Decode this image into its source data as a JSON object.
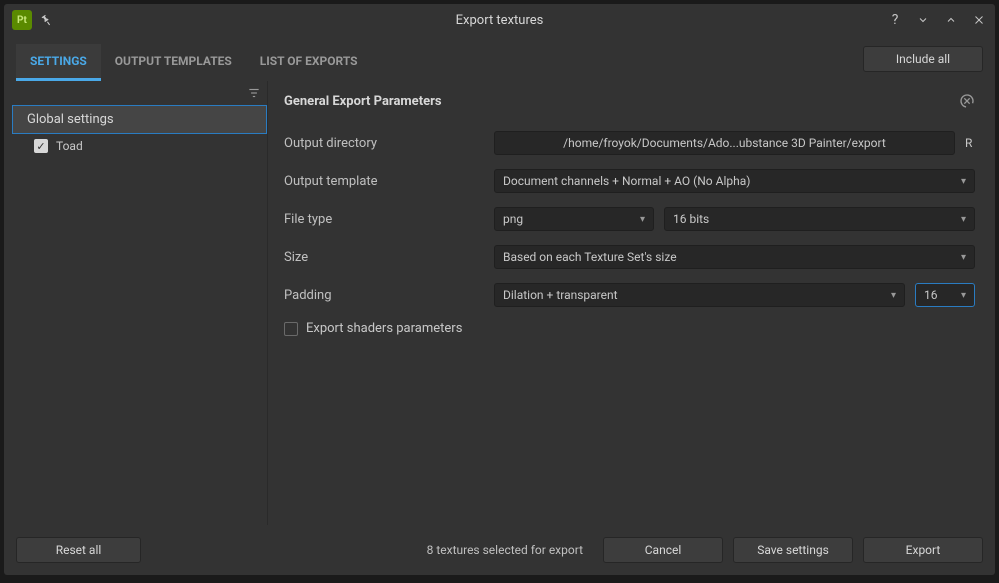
{
  "window": {
    "title": "Export textures",
    "app_icon_text": "Pt"
  },
  "toolbar": {
    "tabs": [
      {
        "label": "SETTINGS",
        "active": true
      },
      {
        "label": "OUTPUT TEMPLATES",
        "active": false
      },
      {
        "label": "LIST OF EXPORTS",
        "active": false
      }
    ],
    "include_all": "Include all"
  },
  "sidebar": {
    "header": "Global settings",
    "items": [
      {
        "label": "Toad",
        "checked": true
      }
    ]
  },
  "content": {
    "title": "General Export Parameters",
    "output_directory": {
      "label": "Output directory",
      "value": "/home/froyok/Documents/Ado...ubstance 3D Painter/export",
      "suffix": "R"
    },
    "output_template": {
      "label": "Output template",
      "value": "Document channels + Normal + AO (No Alpha)"
    },
    "file_type": {
      "label": "File type",
      "format": "png",
      "depth": "16 bits"
    },
    "size": {
      "label": "Size",
      "value": "Based on each Texture Set's size"
    },
    "padding": {
      "label": "Padding",
      "mode": "Dilation + transparent",
      "amount": "16"
    },
    "export_shaders": {
      "label": "Export shaders parameters",
      "checked": false
    }
  },
  "footer": {
    "reset_all": "Reset all",
    "status": "8 textures selected for export",
    "cancel": "Cancel",
    "save_settings": "Save settings",
    "export": "Export"
  }
}
